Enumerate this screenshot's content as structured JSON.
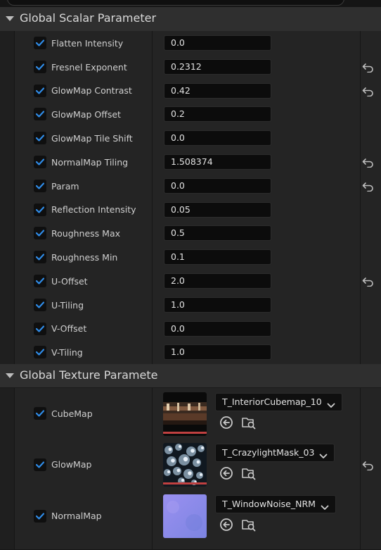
{
  "scalar_section": {
    "title": "Global Scalar Parameter",
    "rows": [
      {
        "name": "Flatten Intensity",
        "value": "0.0",
        "reset": false
      },
      {
        "name": "Fresnel Exponent",
        "value": "0.2312",
        "reset": true
      },
      {
        "name": "GlowMap Contrast",
        "value": "0.42",
        "reset": true
      },
      {
        "name": "GlowMap Offset",
        "value": "0.2",
        "reset": false
      },
      {
        "name": "GlowMap Tile Shift",
        "value": "0.0",
        "reset": false
      },
      {
        "name": "NormalMap Tiling",
        "value": "1.508374",
        "reset": true
      },
      {
        "name": "Param",
        "value": "0.0",
        "reset": true
      },
      {
        "name": "Reflection Intensity",
        "value": "0.05",
        "reset": false
      },
      {
        "name": "Roughness Max",
        "value": "0.5",
        "reset": false
      },
      {
        "name": "Roughness Min",
        "value": "0.1",
        "reset": false
      },
      {
        "name": "U-Offset",
        "value": "2.0",
        "reset": true
      },
      {
        "name": "U-Tiling",
        "value": "1.0",
        "reset": false
      },
      {
        "name": "V-Offset",
        "value": "0.0",
        "reset": false
      },
      {
        "name": "V-Tiling",
        "value": "1.0",
        "reset": false
      }
    ]
  },
  "texture_section": {
    "title": "Global Texture Paramete",
    "rows": [
      {
        "name": "CubeMap",
        "asset": "T_InteriorCubemap_10",
        "reset": false,
        "thumb": "cubemap"
      },
      {
        "name": "GlowMap",
        "asset": "T_CrazylightMask_03",
        "reset": true,
        "thumb": "glow"
      },
      {
        "name": "NormalMap",
        "asset": "T_WindowNoise_NRM",
        "reset": false,
        "thumb": "normal"
      }
    ]
  },
  "colors": {
    "checkbox_check": "#2f8ce8",
    "normal_thumb": "#8a86e8",
    "panel_bg": "#242424"
  }
}
